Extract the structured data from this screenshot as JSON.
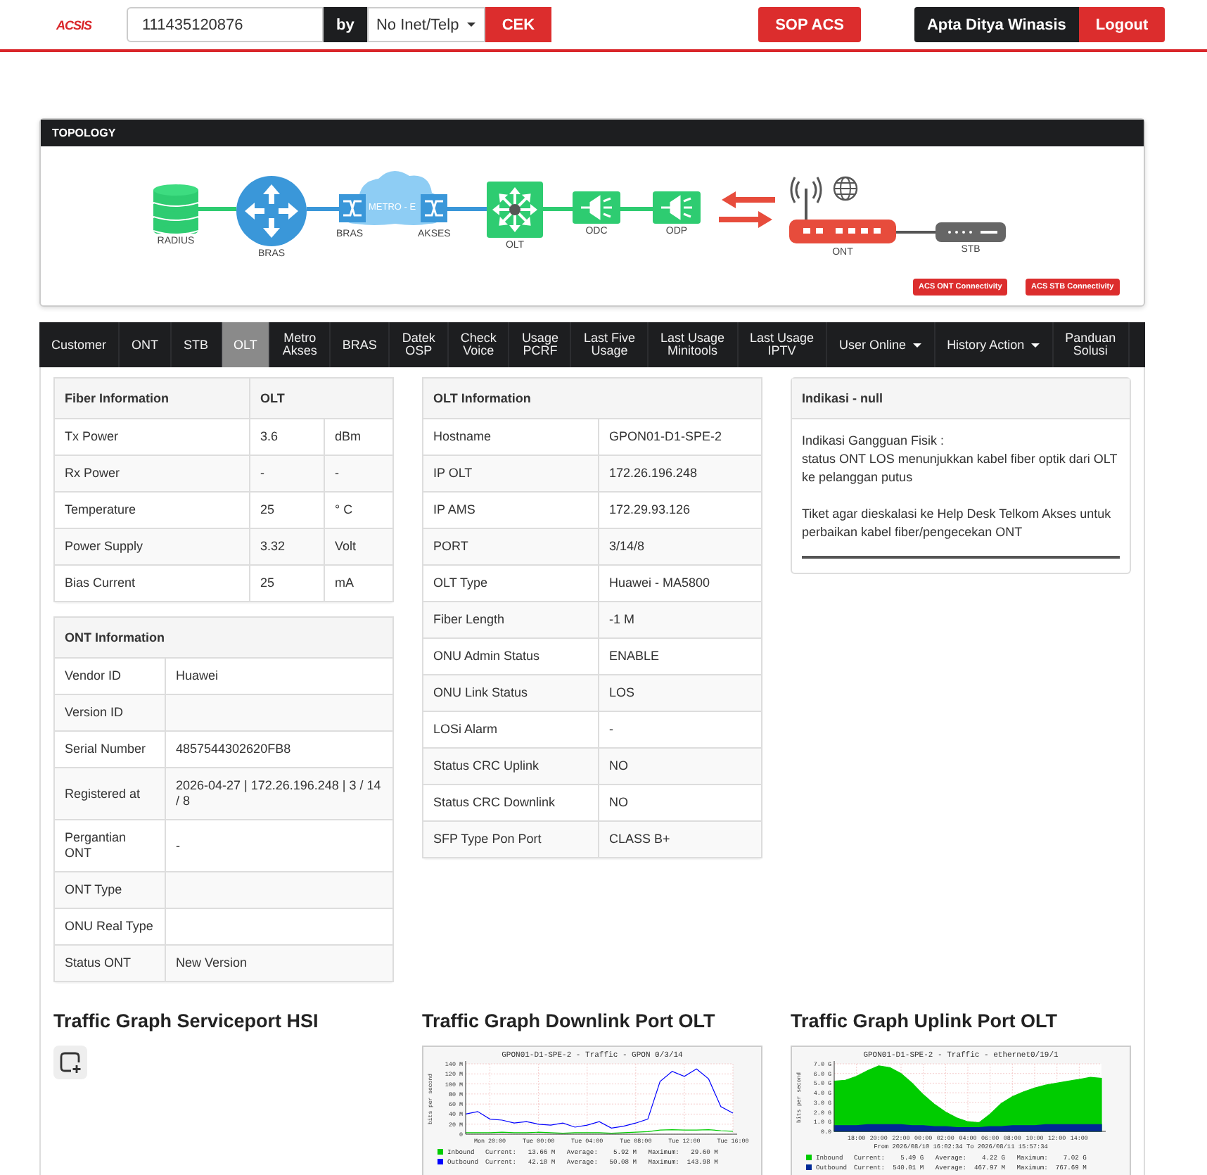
{
  "header": {
    "logo": "ACSIS",
    "search": {
      "value": "111435120876"
    },
    "by_label": "by",
    "filter": {
      "value": "No Inet/Telp"
    },
    "check_button": "CEK",
    "sop_button": "SOP ACS",
    "user": "Apta Ditya Winasis",
    "logout": "Logout"
  },
  "topology": {
    "title": "TOPOLOGY",
    "nodes": [
      {
        "kind": "database",
        "label": "RADIUS"
      },
      {
        "kind": "router",
        "label": "BRAS"
      },
      {
        "kind": "cloud",
        "label": "METRO - E",
        "left_label": "BRAS",
        "right_label": "AKSES"
      },
      {
        "kind": "olt",
        "label": "OLT"
      },
      {
        "kind": "splitter",
        "label": "ODC"
      },
      {
        "kind": "splitter",
        "label": "ODP"
      },
      {
        "kind": "modem",
        "label": "ONT"
      },
      {
        "kind": "settop",
        "label": "STB"
      }
    ],
    "buttons": [
      "ACS ONT Connectivity",
      "ACS STB Connectivity"
    ]
  },
  "tabs": [
    {
      "label": "Customer",
      "selected": false,
      "dropdown": false
    },
    {
      "label": "ONT",
      "selected": false,
      "dropdown": false
    },
    {
      "label": "STB",
      "selected": false,
      "dropdown": false
    },
    {
      "label": "OLT",
      "selected": true,
      "dropdown": false
    },
    {
      "label": "Metro\nAkses",
      "selected": false,
      "dropdown": false
    },
    {
      "label": "BRAS",
      "selected": false,
      "dropdown": false
    },
    {
      "label": "Datek\nOSP",
      "selected": false,
      "dropdown": false
    },
    {
      "label": "Check\nVoice",
      "selected": false,
      "dropdown": false
    },
    {
      "label": "Usage\nPCRF",
      "selected": false,
      "dropdown": false
    },
    {
      "label": "Last Five\nUsage",
      "selected": false,
      "dropdown": false
    },
    {
      "label": "Last Usage\nMinitools",
      "selected": false,
      "dropdown": false
    },
    {
      "label": "Last Usage\nIPTV",
      "selected": false,
      "dropdown": false
    },
    {
      "label": "User Online",
      "selected": false,
      "dropdown": true
    },
    {
      "label": "History Action",
      "selected": false,
      "dropdown": true
    },
    {
      "label": "Panduan\nSolusi",
      "selected": false,
      "dropdown": false
    }
  ],
  "fiber_info": {
    "headers": [
      "Fiber Information",
      "OLT"
    ],
    "rows": [
      [
        "Tx Power",
        "3.6",
        "dBm"
      ],
      [
        "Rx Power",
        "-",
        "-"
      ],
      [
        "Temperature",
        "25",
        "° C"
      ],
      [
        "Power Supply",
        "3.32",
        "Volt"
      ],
      [
        "Bias Current",
        "25",
        "mA"
      ]
    ]
  },
  "ont_info": {
    "title": "ONT Information",
    "rows": [
      {
        "label": "Vendor ID",
        "value": "Huawei"
      },
      {
        "label": "Version ID"
      },
      {
        "label": "Serial Number",
        "value": "4857544302620FB8"
      },
      {
        "label": "Registered at",
        "value": "2026-04-27 | 172.26.196.248 | 3 / 14 / 8"
      },
      {
        "label": "Pergantian ONT",
        "value": "-"
      },
      {
        "label": "ONT Type"
      },
      {
        "label": "ONU Real Type"
      },
      {
        "label": "Status ONT",
        "value": "New Version"
      }
    ]
  },
  "olt_info": {
    "title": "OLT Information",
    "rows": [
      {
        "label": "Hostname",
        "value": "GPON01-D1-SPE-2"
      },
      {
        "label": "IP OLT",
        "value": "172.26.196.248"
      },
      {
        "label": "IP AMS",
        "value": "172.29.93.126"
      },
      {
        "label": "PORT",
        "value": "3/14/8"
      },
      {
        "label": "OLT Type",
        "value": "Huawei - MA5800"
      },
      {
        "label": "Fiber Length",
        "value": "-1 M"
      },
      {
        "label": "ONU Admin Status",
        "value": "ENABLE"
      },
      {
        "label": "ONU Link Status",
        "value": "LOS"
      },
      {
        "label": "LOSi Alarm",
        "value": "-"
      },
      {
        "label": "Status CRC Uplink",
        "value": "NO"
      },
      {
        "label": "Status CRC Downlink",
        "value": "NO"
      },
      {
        "label": "SFP Type Pon Port",
        "value": "CLASS B+"
      }
    ]
  },
  "indication": {
    "title": "Indikasi - null",
    "paragraphs": [
      "Indikasi Gangguan Fisik :",
      "status ONT LOS menunjukkan kabel fiber optik dari OLT ke pelanggan putus",
      "Tiket agar dieskalasi ke Help Desk Telkom Akses untuk perbaikan kabel fiber/pengecekan ONT"
    ]
  },
  "graphs": [
    {
      "title": "Traffic Graph Serviceport HSI",
      "kind": "empty"
    },
    {
      "title": "Traffic Graph Downlink Port OLT",
      "kind": "chart",
      "legend": [
        "Current:   13.66 M   Average:    5.92 M   Maximum:   29.60 M",
        "Current:   42.18 M   Average:   50.08 M   Maximum:  143.98 M"
      ],
      "chart_data": {
        "type": "line",
        "title": "GPON01-D1-SPE-2  - Traffic - GPON 0/3/14",
        "ylabel": "bits per second",
        "categories": [
          null,
          null,
          "Mon 20:00",
          null,
          null,
          null,
          "Tue 00:00",
          null,
          null,
          null,
          "Tue 04:00",
          null,
          null,
          null,
          "Tue 08:00",
          null,
          null,
          null,
          "Tue 12:00",
          null,
          null,
          null,
          "Tue 16:00"
        ],
        "series": [
          {
            "name": "Inbound",
            "color": "#00cc00",
            "values": [
              3,
              3,
              3,
              4,
              3,
              3,
              4,
              3,
              2,
              3,
              3,
              3,
              2,
              3,
              4,
              5,
              8,
              9,
              8,
              8,
              9,
              7,
              6
            ]
          },
          {
            "name": "Outbound",
            "color": "#0000ff",
            "values": [
              40,
              45,
              30,
              28,
              22,
              25,
              20,
              18,
              22,
              14,
              18,
              25,
              12,
              16,
              22,
              30,
              105,
              125,
              115,
              130,
              110,
              55,
              42
            ]
          }
        ],
        "ylim": [
          0,
          140
        ],
        "grid": true,
        "legend": "bottom",
        "yticks": [
          {
            "value": 0,
            "label": "0"
          },
          {
            "value": 20,
            "label": "20 M"
          },
          {
            "value": 40,
            "label": "40 M"
          },
          {
            "value": 60,
            "label": "60 M"
          },
          {
            "value": 80,
            "label": "80 M"
          },
          {
            "value": 100,
            "label": "100 M"
          },
          {
            "value": 120,
            "label": "120 M"
          },
          {
            "value": 140,
            "label": "140 M"
          }
        ]
      }
    },
    {
      "title": "Traffic Graph Uplink Port OLT",
      "kind": "chart",
      "period": "From 2026/08/10 16:02:34 To 2026/08/11 15:57:34",
      "legend": [
        "Current:    5.49 G   Average:    4.22 G   Maximum:    7.02 G",
        "Current:  540.01 M   Average:  467.97 M   Maximum:  767.69 M"
      ],
      "chart_data": {
        "type": "area",
        "title": "GPON01-D1-SPE-2 - Traffic - ethernet0/19/1",
        "ylabel": "bits per second",
        "categories": [
          null,
          null,
          "18:00",
          null,
          "20:00",
          null,
          "22:00",
          null,
          "00:00",
          null,
          "02:00",
          null,
          "04:00",
          null,
          "06:00",
          null,
          "08:00",
          null,
          "10:00",
          null,
          "12:00",
          null,
          "14:00",
          null,
          null
        ],
        "series": [
          {
            "name": "Inbound",
            "color": "#00cc00",
            "values": [
              5.2,
              5.3,
              5.7,
              6.3,
              6.8,
              6.6,
              6.0,
              5.0,
              3.8,
              2.8,
              2.0,
              1.4,
              1.0,
              0.9,
              1.8,
              2.9,
              3.6,
              4.1,
              4.5,
              4.8,
              5.0,
              5.2,
              5.4,
              5.6,
              5.5
            ]
          },
          {
            "name": "Outbound",
            "color": "#002a97",
            "values": [
              0.6,
              0.6,
              0.6,
              0.7,
              0.7,
              0.7,
              0.7,
              0.6,
              0.6,
              0.5,
              0.5,
              0.4,
              0.4,
              0.4,
              0.5,
              0.5,
              0.6,
              0.6,
              0.6,
              0.7,
              0.7,
              0.7,
              0.7,
              0.7,
              0.7
            ]
          }
        ],
        "ylim": [
          0,
          7
        ],
        "grid": true,
        "legend": "bottom",
        "yticks": [
          {
            "value": 0,
            "label": "0.0"
          },
          {
            "value": 1,
            "label": "1.0 G"
          },
          {
            "value": 2,
            "label": "2.0 G"
          },
          {
            "value": 3,
            "label": "3.0 G"
          },
          {
            "value": 4,
            "label": "4.0 G"
          },
          {
            "value": 5,
            "label": "5.0 G"
          },
          {
            "value": 6,
            "label": "6.0 G"
          },
          {
            "value": 7,
            "label": "7.0 G"
          }
        ]
      }
    }
  ]
}
